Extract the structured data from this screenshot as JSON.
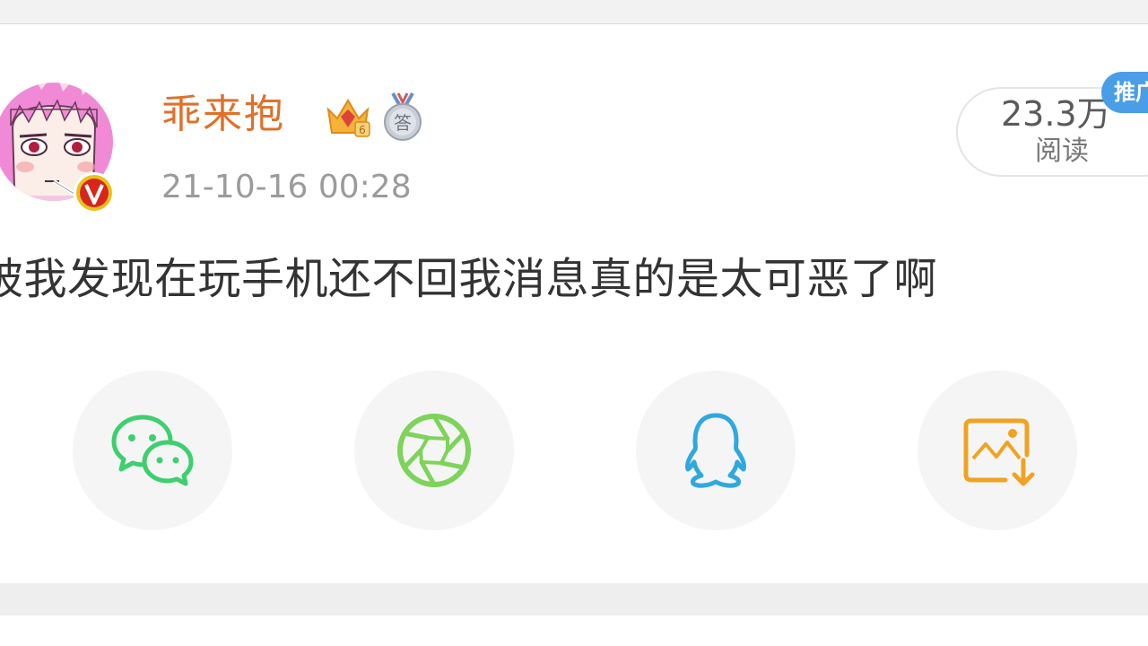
{
  "post": {
    "username": "乖来抱",
    "timestamp": "21-10-16 00:28",
    "read_count": "23.3万",
    "read_label": "阅读",
    "promo_badge": "推广",
    "text": "被我发现在玩手机还不回我消息真的是太可恶了啊",
    "badges": {
      "crown_level": "6",
      "medal_char": "答"
    }
  },
  "share_options": [
    {
      "name": "wechat",
      "icon": "wechat-icon",
      "color": "#3ecf6f"
    },
    {
      "name": "moments",
      "icon": "moments-aperture-icon",
      "color": "#7ed35a"
    },
    {
      "name": "qq",
      "icon": "qq-penguin-icon",
      "color": "#2fa8e0"
    },
    {
      "name": "save-image",
      "icon": "save-image-icon",
      "color": "#f0a321"
    }
  ],
  "colors": {
    "username": "#e0702a",
    "timestamp": "#9b9b9b",
    "promo_badge": "#4a9ee8",
    "v_badge": "#e8c21a"
  }
}
